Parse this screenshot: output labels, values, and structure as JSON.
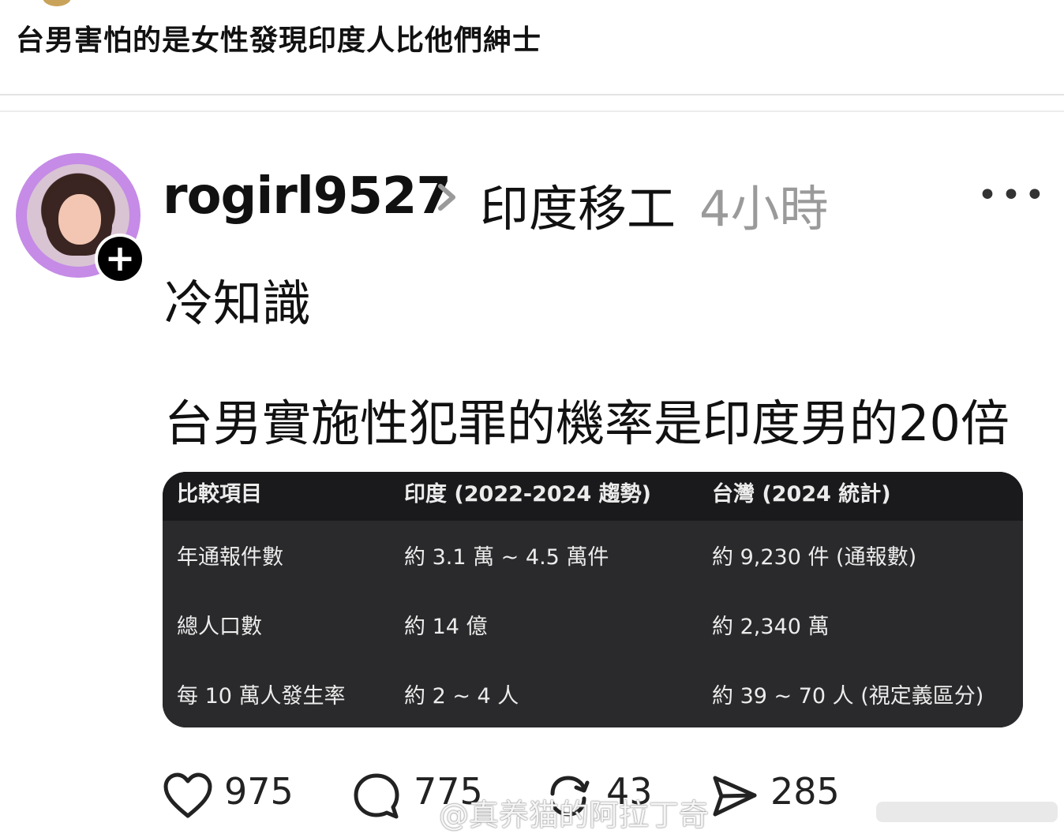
{
  "header": {
    "title": "台男害怕的是女性發現印度人比他們紳士"
  },
  "post": {
    "username": "rogirl9527",
    "topic": "印度移工",
    "time": "4小時",
    "more_label": "•••",
    "follow_label": "+",
    "line1": "冷知識",
    "line2": "台男實施性犯罪的機率是印度男的20倍"
  },
  "table": {
    "headers": [
      "比較項目",
      "印度 (2022-2024 趨勢)",
      "台灣 (2024 統計)"
    ],
    "rows": [
      [
        "年通報件數",
        "約 3.1 萬 ~ 4.5 萬件",
        "約 9,230 件 (通報數)"
      ],
      [
        "總人口數",
        "約 14 億",
        "約 2,340 萬"
      ],
      [
        "每 10 萬人發生率",
        "約 2 ~ 4 人",
        "約 39 ~ 70 人 (視定義區分)"
      ]
    ]
  },
  "actions": {
    "likes": "975",
    "comments": "775",
    "reposts": "43",
    "shares": "285"
  },
  "watermark": "@真养猫的阿拉丁奇",
  "icons": {
    "heart": "heart-icon",
    "comment": "comment-icon",
    "repost": "repost-icon",
    "share": "share-icon",
    "chevron": "chevron-right-icon"
  },
  "colors": {
    "avatar_ring": "#c58be6",
    "table_bg": "#2a2a2c",
    "time_text": "#9a9a9a"
  }
}
